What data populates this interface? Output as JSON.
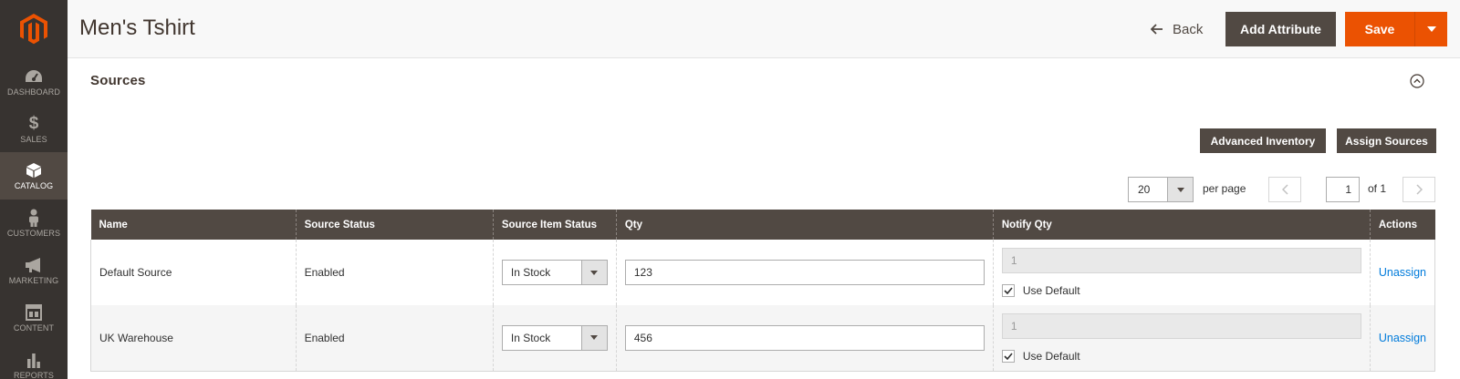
{
  "sidebar": {
    "items": [
      {
        "label": "DASHBOARD",
        "icon": "dashboard-icon"
      },
      {
        "label": "SALES",
        "icon": "dollar-icon"
      },
      {
        "label": "CATALOG",
        "icon": "catalog-box-icon",
        "active": true
      },
      {
        "label": "CUSTOMERS",
        "icon": "person-icon"
      },
      {
        "label": "MARKETING",
        "icon": "megaphone-icon"
      },
      {
        "label": "CONTENT",
        "icon": "content-layout-icon"
      },
      {
        "label": "REPORTS",
        "icon": "bar-chart-icon"
      }
    ]
  },
  "header": {
    "title": "Men's Tshirt",
    "back_label": "Back",
    "add_attribute_label": "Add Attribute",
    "save_label": "Save"
  },
  "section": {
    "title": "Sources",
    "advanced_inventory_label": "Advanced Inventory",
    "assign_sources_label": "Assign Sources"
  },
  "pager": {
    "per_page_value": "20",
    "per_page_label": "per page",
    "current_page": "1",
    "of_label": "of 1"
  },
  "grid": {
    "columns": [
      "Name",
      "Source Status",
      "Source Item Status",
      "Qty",
      "Notify Qty",
      "Actions"
    ],
    "rows": [
      {
        "name": "Default Source",
        "source_status": "Enabled",
        "item_status": "In Stock",
        "qty": "123",
        "notify_qty": "1",
        "use_default": "Use Default",
        "action": "Unassign"
      },
      {
        "name": "UK Warehouse",
        "source_status": "Enabled",
        "item_status": "In Stock",
        "qty": "456",
        "notify_qty": "1",
        "use_default": "Use Default",
        "action": "Unassign"
      }
    ]
  },
  "colors": {
    "sidebar_bg": "#373330",
    "accent_orange": "#eb5202",
    "dark_button": "#514943",
    "link_blue": "#007bdb"
  }
}
